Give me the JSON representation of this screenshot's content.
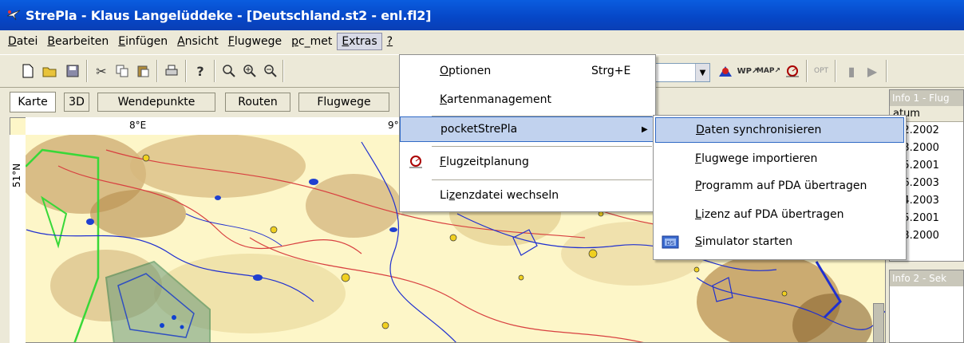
{
  "window": {
    "title": "StrePla - Klaus Langelüddeke - [Deutschland.st2 - enl.fl2]"
  },
  "menubar": {
    "items": [
      {
        "u": "D",
        "rest": "atei"
      },
      {
        "u": "B",
        "rest": "earbeiten"
      },
      {
        "u": "E",
        "rest": "infügen"
      },
      {
        "u": "A",
        "rest": "nsicht"
      },
      {
        "u": "F",
        "rest": "lugwege"
      },
      {
        "u": "p",
        "rest": "c_met"
      },
      {
        "u": "E",
        "rest": "xtras"
      },
      {
        "u": "?",
        "rest": ""
      }
    ]
  },
  "tabs": [
    "Karte",
    "3D",
    "Wendepunkte",
    "Routen",
    "Flugwege"
  ],
  "map": {
    "lon_label_1": "8°E",
    "lon_label_2": "9°",
    "lat_label": "51°N"
  },
  "extras_menu": {
    "optionen": {
      "u": "O",
      "rest": "ptionen",
      "shortcut": "Strg+E"
    },
    "kartenmanagement": {
      "u": "K",
      "rest": "artenmanagement"
    },
    "pocketstrepla": {
      "label": "pocketStrePla"
    },
    "flugzeitplanung": {
      "u": "F",
      "rest": "lugzeitplanung"
    },
    "lizenzdatei": {
      "pre": "Li",
      "u": "z",
      "rest": "enzdatei wechseln"
    }
  },
  "submenu": {
    "daten": {
      "u": "D",
      "rest": "aten synchronisieren"
    },
    "flugwege": {
      "u": "F",
      "rest": "lugwege importieren"
    },
    "programm": {
      "u": "P",
      "rest": "rogramm auf PDA übertragen"
    },
    "lizenz": {
      "u": "L",
      "rest": "izenz auf PDA übertragen"
    },
    "simulator": {
      "u": "S",
      "rest": "imulator starten"
    }
  },
  "info1": {
    "header": "Info 1 - Flug",
    "column": "atum",
    "rows": [
      ".12.2002",
      ".03.2000",
      ".05.2001",
      ".06.2003",
      ".04.2003",
      ".05.2001",
      ".03.2000"
    ]
  },
  "info2": {
    "header": "Info 2 - Sek"
  }
}
